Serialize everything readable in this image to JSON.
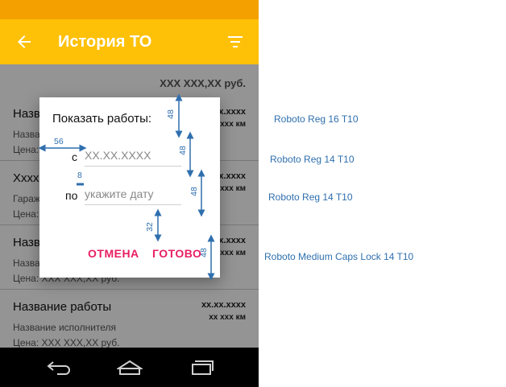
{
  "appbar": {
    "title": "История ТО"
  },
  "summary": {
    "total": "XXX XXX,XX руб."
  },
  "items": [
    {
      "name": "Название работы",
      "sub": "Название исполнителя",
      "price": "Цена: XXX XXX,XX руб.",
      "date": "xx.xx.xxxx",
      "km": "xx xxx км"
    },
    {
      "name": "Xxxxxxxxxxxxxxx",
      "sub": "Гараж на Садовом",
      "price": "Цена: XXX XXX,XX руб.",
      "date": "xx.xx.xxxx",
      "km": "xx xxx км"
    },
    {
      "name": "Название работы",
      "sub": "Название исполнителя",
      "price": "Цена: XXX XXX,XX руб.",
      "date": "xx.xx.xxxx",
      "km": "xx xxx км"
    },
    {
      "name": "Название работы",
      "sub": "Название исполнителя",
      "price": "Цена: XXX XXX,XX руб.",
      "date": "xx.xx.xxxx",
      "km": "xx xxx км"
    }
  ],
  "dialog": {
    "title": "Показать работы:",
    "from_label": "с",
    "from_value": "XX.XX.XXXX",
    "to_label": "по",
    "to_placeholder": "укажите дату",
    "cancel": "ОТМЕНА",
    "done": "ГОТОВО"
  },
  "spec": {
    "dims": [
      "48",
      "56",
      "48",
      "8",
      "48",
      "32",
      "48"
    ],
    "notes": [
      "Roboto Reg 16 T10",
      "Roboto Reg 14 T10",
      "Roboto Reg 14 T10",
      "Roboto Medium Caps Lock 14 T10"
    ]
  },
  "colors": {
    "statusbar": "#f4a100",
    "appbar": "#ffc107",
    "accent": "#e91e63",
    "spec": "#2f6fae"
  },
  "icons": {
    "back": "arrow-back-icon",
    "filter": "filter-icon",
    "nav_back": "nav-back-icon",
    "nav_home": "nav-home-icon",
    "nav_recents": "nav-recents-icon"
  }
}
